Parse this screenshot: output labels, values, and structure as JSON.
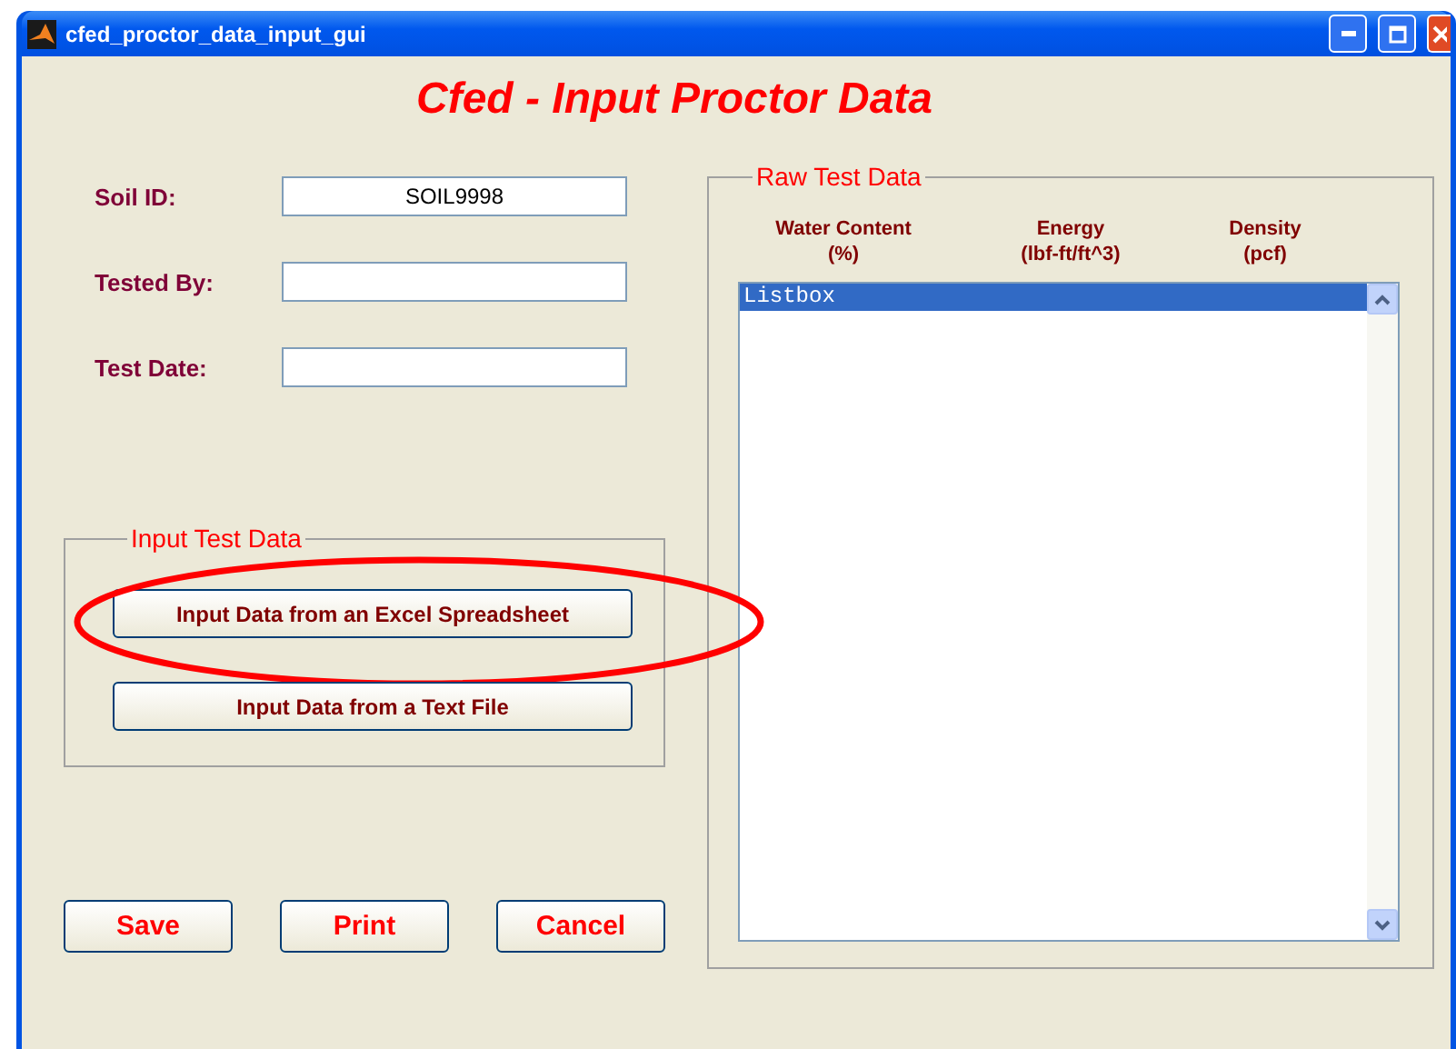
{
  "window": {
    "title": "cfed_proctor_data_input_gui"
  },
  "heading": "Cfed - Input Proctor Data",
  "fields": [
    {
      "label": "Soil ID:",
      "value": "SOIL9998"
    },
    {
      "label": "Tested By:"
    },
    {
      "label": "Test Date:"
    }
  ],
  "input_group": {
    "title": "Input Test Data",
    "buttons": [
      {
        "label": "Input Data from an Excel Spreadsheet",
        "highlighted": true
      },
      {
        "label": "Input Data from a Text File",
        "highlighted": false
      }
    ]
  },
  "raw_panel": {
    "title": "Raw Test Data",
    "columns": [
      {
        "title": "Water Content",
        "unit": "(%)"
      },
      {
        "title": "Energy",
        "unit": "(lbf-ft/ft^3)"
      },
      {
        "title": "Density",
        "unit": "(pcf)"
      }
    ],
    "listbox": {
      "items": [
        {
          "text": "Listbox",
          "selected": true
        }
      ]
    }
  },
  "buttons": [
    "Save",
    "Print",
    "Cancel"
  ]
}
